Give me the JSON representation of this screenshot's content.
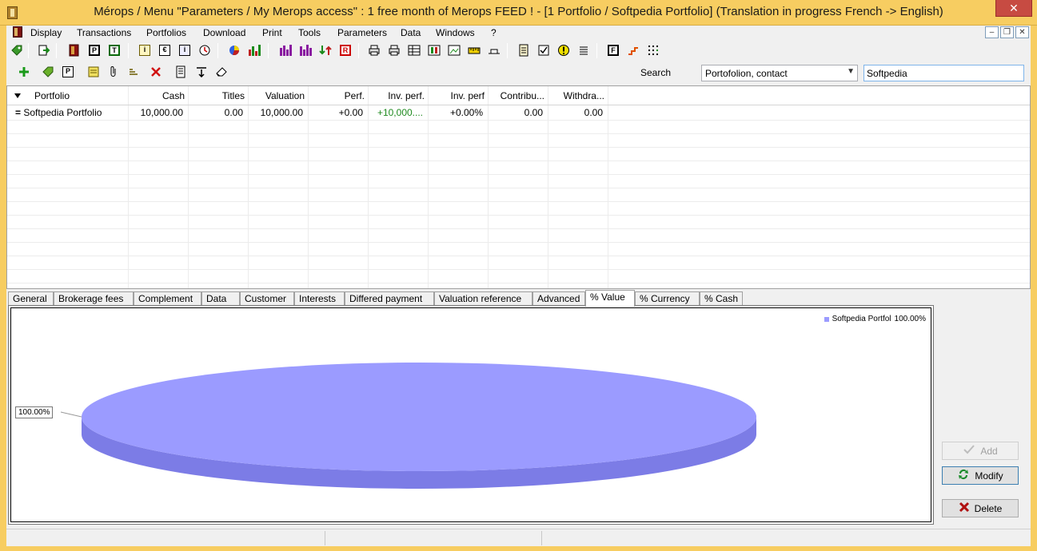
{
  "window": {
    "title": "Mérops / Menu \"Parameters / My Merops access\" : 1 free month of Merops FEED ! - [1 Portfolio / Softpedia Portfolio] (Translation in progress French -> English)",
    "close_glyph": "✕"
  },
  "menu": {
    "items": [
      "Display",
      "Transactions",
      "Portfolios",
      "Download",
      "Print",
      "Tools",
      "Parameters",
      "Data",
      "Windows",
      "?"
    ]
  },
  "mdi_buttons": [
    "–",
    "❐",
    "✕"
  ],
  "toolbar": {
    "icons": [
      "tag-icon",
      "export-icon",
      "book-icon",
      "p-box-icon",
      "t-box-icon",
      "info-icon",
      "euro-icon",
      "info-card-icon",
      "clock-icon",
      "pie-icon",
      "bars-icon",
      "bars-purple-icon",
      "bars-purple2-icon",
      "updown-icon",
      "r-box-icon",
      "printer-icon",
      "printer2-icon",
      "table-icon",
      "columns-icon",
      "image-icon",
      "ruler-icon",
      "flat-icon",
      "doc-icon",
      "checkbox-icon",
      "warning-icon",
      "list-icon",
      "f-box-icon",
      "stairs-icon",
      "grid-dots-icon"
    ]
  },
  "search": {
    "label": "Search",
    "scope_value": "Portofolion, contact",
    "query": "Softpedia"
  },
  "grid": {
    "columns": [
      "Portfolio",
      "Cash",
      "Titles",
      "Valuation",
      "Perf.",
      "Inv. perf.",
      "Inv. perf",
      "Contribu...",
      "Withdra..."
    ],
    "rows": [
      {
        "marker": "=",
        "portfolio": "Softpedia Portfolio",
        "cash": "10,000.00",
        "titles": "0.00",
        "valuation": "10,000.00",
        "perf": "+0.00",
        "inv_perf": "+10,000....",
        "inv_perf_pct": "+0.00%",
        "contrib": "0.00",
        "withdraw": "0.00"
      }
    ]
  },
  "tabs": [
    "General",
    "Brokerage fees",
    "Complement",
    "Data",
    "Customer",
    "Interests",
    "Differed payment",
    "Valuation reference",
    "Advanced",
    "% Value",
    "% Currency",
    "% Cash"
  ],
  "active_tab": "% Value",
  "chart_data": {
    "type": "pie",
    "categories": [
      "Softpedia Portfol"
    ],
    "values": [
      100.0
    ],
    "slice_labels": [
      "100.00%"
    ],
    "legend_entries": [
      {
        "name": "Softpedia Portfol",
        "value": "100.00%"
      }
    ],
    "legend_placement": "top-right",
    "colors": [
      "#9b9bff"
    ],
    "style": "3d"
  },
  "actions": {
    "add": "Add",
    "modify": "Modify",
    "delete": "Delete"
  }
}
